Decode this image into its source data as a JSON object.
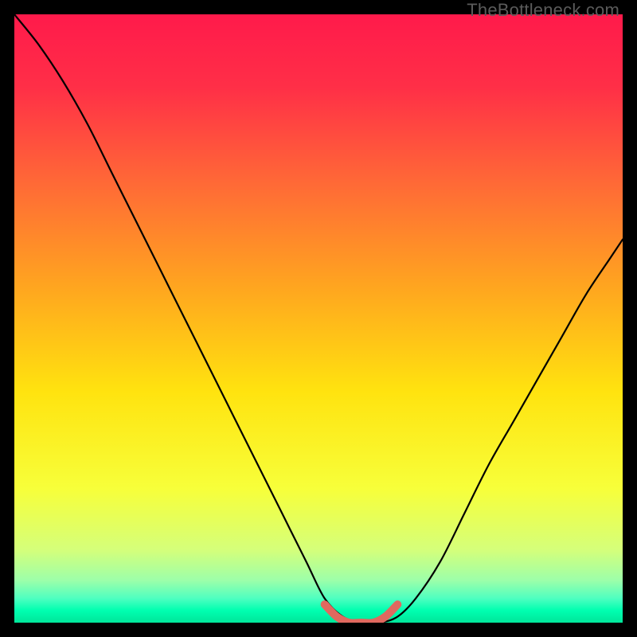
{
  "chart_data": {
    "type": "line",
    "watermark": "TheBottleneck.com",
    "title": "",
    "xlabel": "",
    "ylabel": "",
    "xlim": [
      0,
      100
    ],
    "ylim": [
      0,
      100
    ],
    "background_gradient": {
      "stops": [
        {
          "offset": 0,
          "color": "#ff1a4b"
        },
        {
          "offset": 12,
          "color": "#ff2f47"
        },
        {
          "offset": 28,
          "color": "#ff6a36"
        },
        {
          "offset": 45,
          "color": "#ffa61f"
        },
        {
          "offset": 62,
          "color": "#ffe30f"
        },
        {
          "offset": 78,
          "color": "#f7ff3a"
        },
        {
          "offset": 88,
          "color": "#d5ff7a"
        },
        {
          "offset": 93,
          "color": "#9dffa9"
        },
        {
          "offset": 96,
          "color": "#4fffc0"
        },
        {
          "offset": 98,
          "color": "#00ffb0"
        },
        {
          "offset": 100,
          "color": "#00e69a"
        }
      ]
    },
    "series": [
      {
        "name": "bottleneck-curve",
        "color": "#000000",
        "x": [
          0,
          4,
          8,
          12,
          16,
          20,
          24,
          28,
          32,
          36,
          40,
          44,
          48,
          51,
          54,
          57,
          60,
          63,
          66,
          70,
          74,
          78,
          82,
          86,
          90,
          94,
          98,
          100
        ],
        "y": [
          100,
          95,
          89,
          82,
          74,
          66,
          58,
          50,
          42,
          34,
          26,
          18,
          10,
          4,
          1,
          0,
          0,
          1,
          4,
          10,
          18,
          26,
          33,
          40,
          47,
          54,
          60,
          63
        ]
      },
      {
        "name": "valley-accent",
        "color": "#e0695f",
        "x": [
          51,
          53,
          55,
          57,
          59,
          61,
          63
        ],
        "y": [
          3,
          1,
          0,
          0,
          0,
          1,
          3
        ]
      }
    ]
  }
}
